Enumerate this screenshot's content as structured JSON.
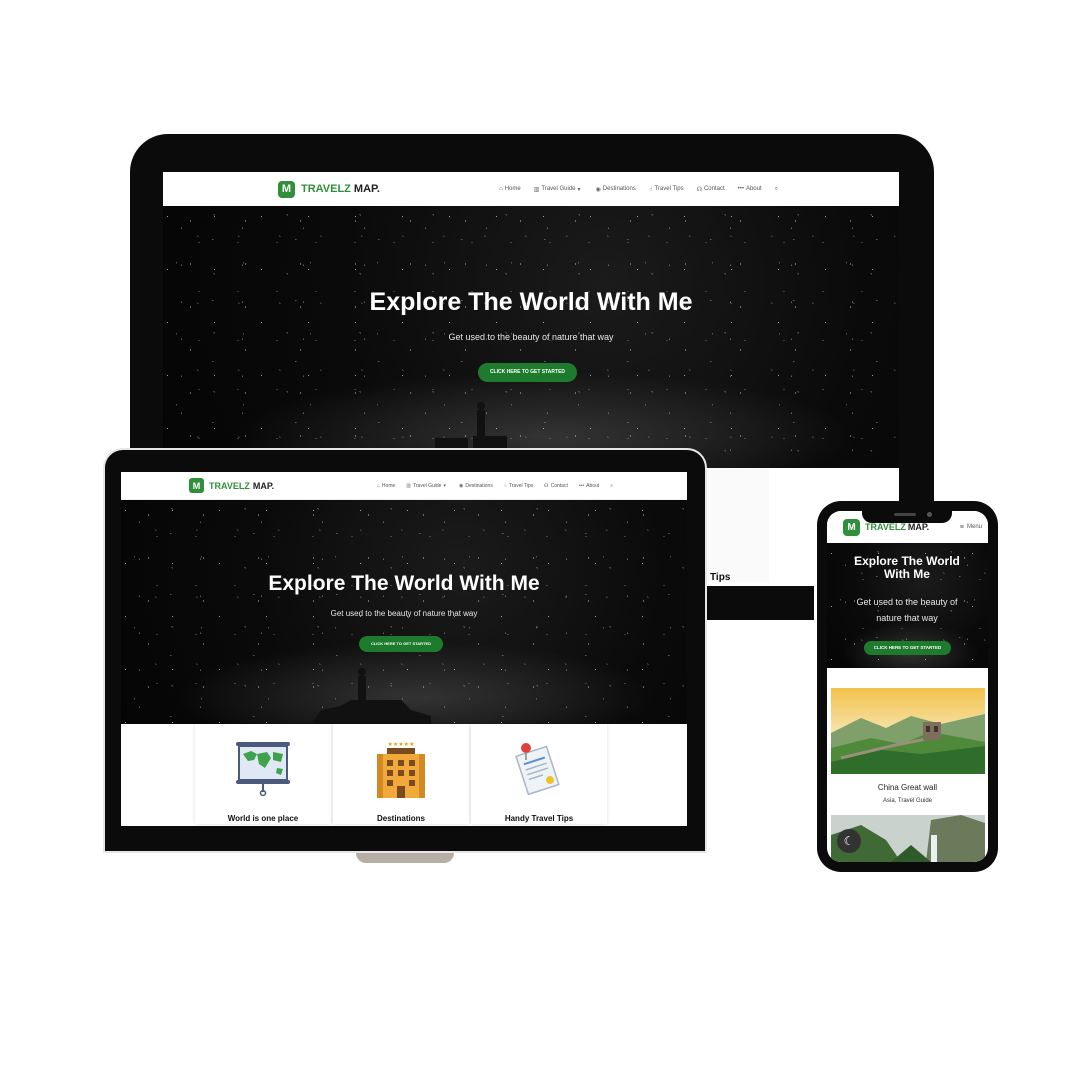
{
  "brand": {
    "logo_letter": "M",
    "name_part1": "TRAVELZ",
    "name_part2": "MAP.",
    "primary_color": "#2f8f3a",
    "cta_color": "#1e7a2c"
  },
  "nav": {
    "items": [
      {
        "label": "Home",
        "icon": "home-icon"
      },
      {
        "label": "Travel Guide",
        "icon": "map-icon"
      },
      {
        "label": "Destinations",
        "icon": "location-pin-icon"
      },
      {
        "label": "Travel Tips",
        "icon": "hand-icon"
      },
      {
        "label": "Contact",
        "icon": "headset-icon"
      },
      {
        "label": "About",
        "icon": "more-icon"
      }
    ],
    "search_icon": "search-icon",
    "mobile_menu_label": "Menu"
  },
  "hero": {
    "title": "Explore The World With Me",
    "subtitle": "Get used to the beauty of nature that way",
    "cta_label": "CLICK HERE TO GET STARTED"
  },
  "features": [
    {
      "title": "World is one place",
      "icon": "world-map-board-icon"
    },
    {
      "title": "Destinations",
      "icon": "hotel-building-icon"
    },
    {
      "title": "Handy Travel Tips",
      "icon": "document-pin-icon"
    }
  ],
  "partial_feature_title": "Tips",
  "mobile_destinations": [
    {
      "title": "China Great wall",
      "category": "Asia, Travel Guide"
    }
  ]
}
